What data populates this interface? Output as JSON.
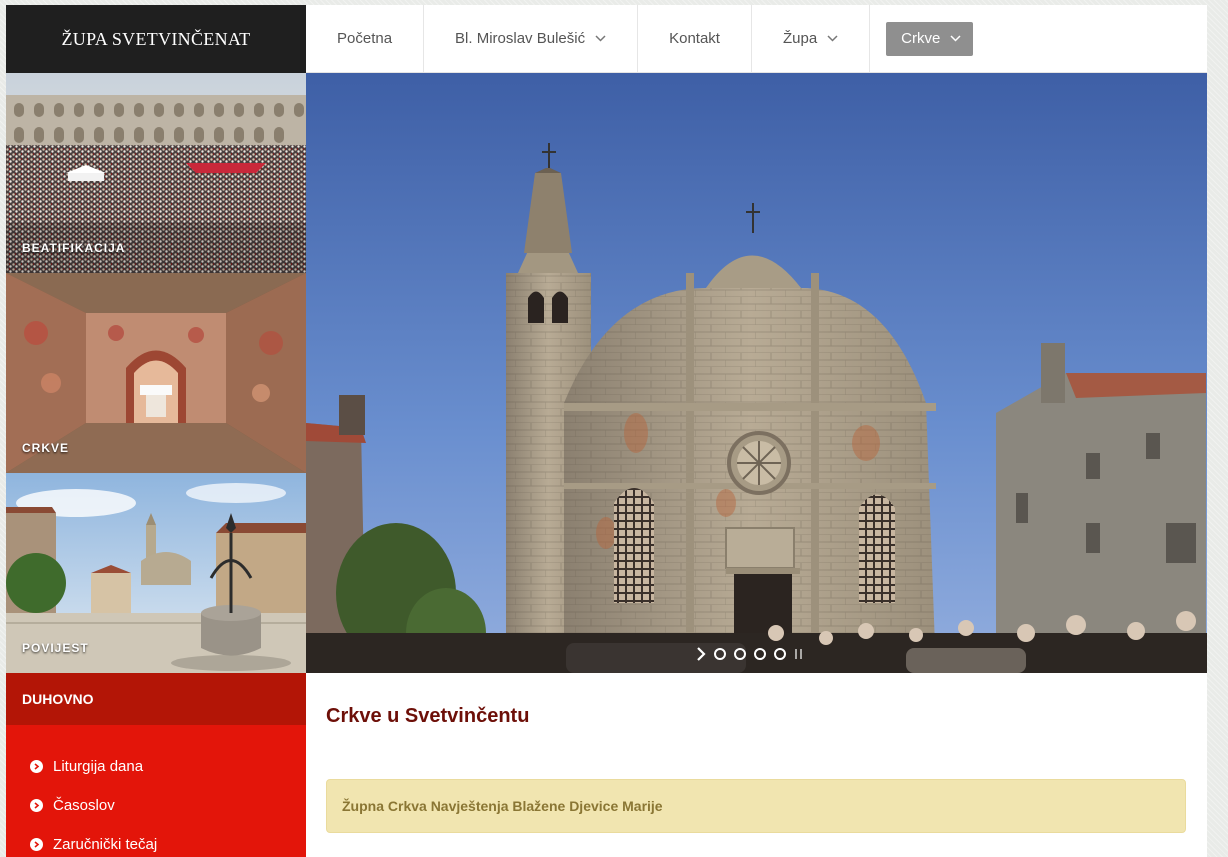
{
  "header": {
    "site_title": "ŽUPA SVETVINČENAT",
    "nav": [
      {
        "label": "Početna",
        "has_dropdown": false
      },
      {
        "label": "Bl. Miroslav Bulešić",
        "has_dropdown": true
      },
      {
        "label": "Kontakt",
        "has_dropdown": false
      },
      {
        "label": "Župa",
        "has_dropdown": true
      },
      {
        "label": "Crkve",
        "has_dropdown": true,
        "active": true
      }
    ]
  },
  "tiles": [
    {
      "label": "BEATIFIKACIJA"
    },
    {
      "label": "CRKVE"
    },
    {
      "label": "POVIJEST"
    }
  ],
  "sidebar": {
    "heading": "DUHOVNO",
    "links": [
      {
        "label": "Liturgija dana",
        "icon": "chevron-circle-right-icon"
      },
      {
        "label": "Časoslov",
        "icon": "chevron-circle-right-icon"
      },
      {
        "label": "Zaručnički tečaj",
        "icon": "chevron-circle-right-icon"
      }
    ]
  },
  "slider": {
    "slide_count": 4,
    "current_slide": 1
  },
  "main": {
    "title": "Crkve u Svetvinčentu",
    "notice": "Župna Crkva Navještenja Blažene Djevice Marije"
  },
  "colors": {
    "logo_bg": "#1f1f1f",
    "sidebar_head": "#b31506",
    "sidebar_body": "#e3150a",
    "title": "#6d0f08",
    "notice_bg": "#f1e5b0",
    "active_nav": "#8f8f8f"
  }
}
